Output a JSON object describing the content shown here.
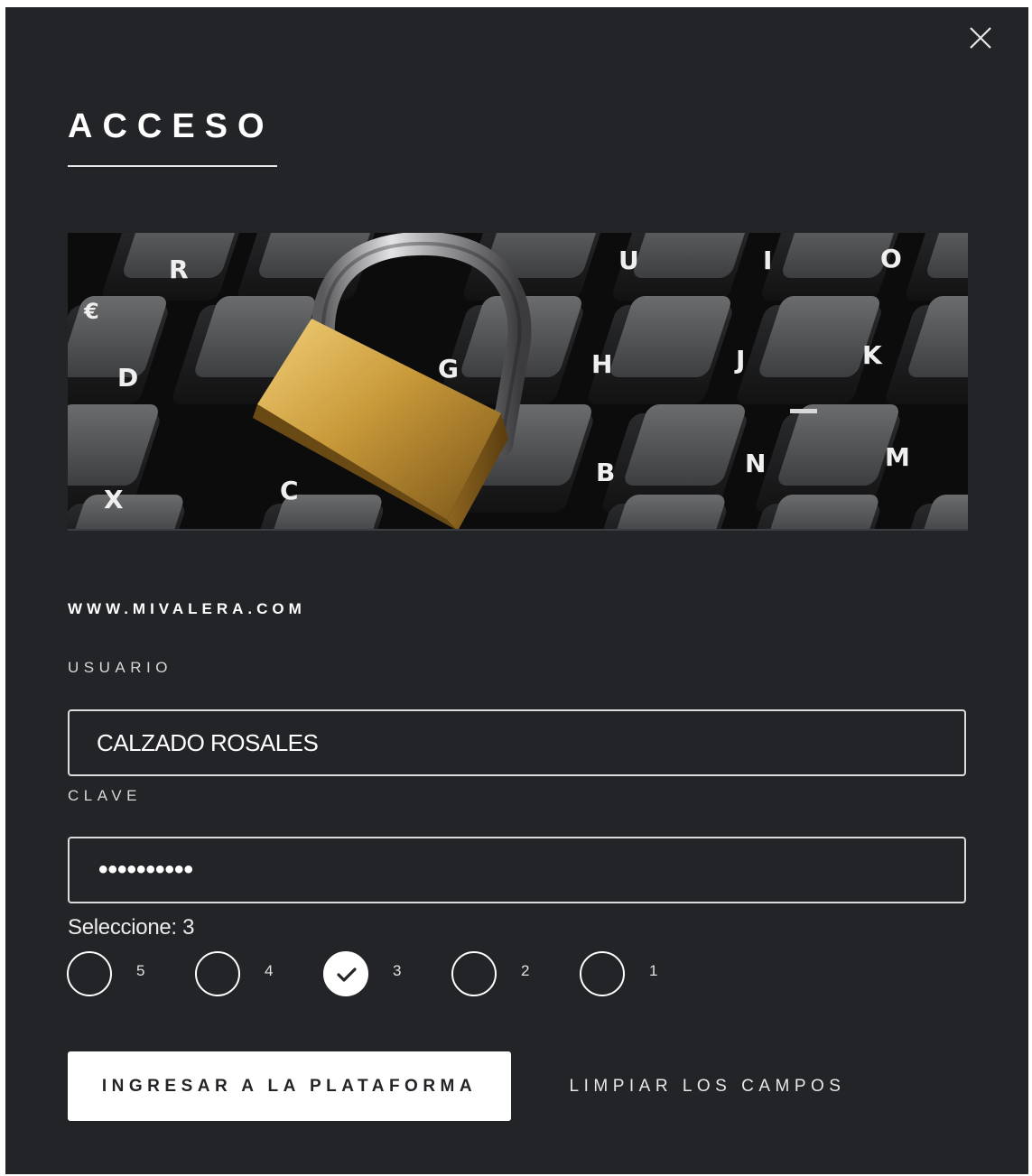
{
  "dialog": {
    "title": "ACCESO",
    "site": "WWW.MIVALERA.COM",
    "image": "padlock-on-keyboard"
  },
  "form": {
    "user_label": "USUARIO",
    "user_value": "CALZADO ROSALES",
    "password_label": "CLAVE",
    "password_value": "••••••••••"
  },
  "selection": {
    "label": "Seleccione: 3",
    "options": [
      "5",
      "4",
      "3",
      "2",
      "1"
    ],
    "selected": "3"
  },
  "actions": {
    "submit_label": "INGRESAR A LA PLATAFORMA",
    "clear_label": "LIMPIAR LOS CAMPOS"
  },
  "colors": {
    "background": "#232427",
    "text": "#ffffff",
    "button_bg": "#ffffff",
    "button_text": "#232427"
  }
}
